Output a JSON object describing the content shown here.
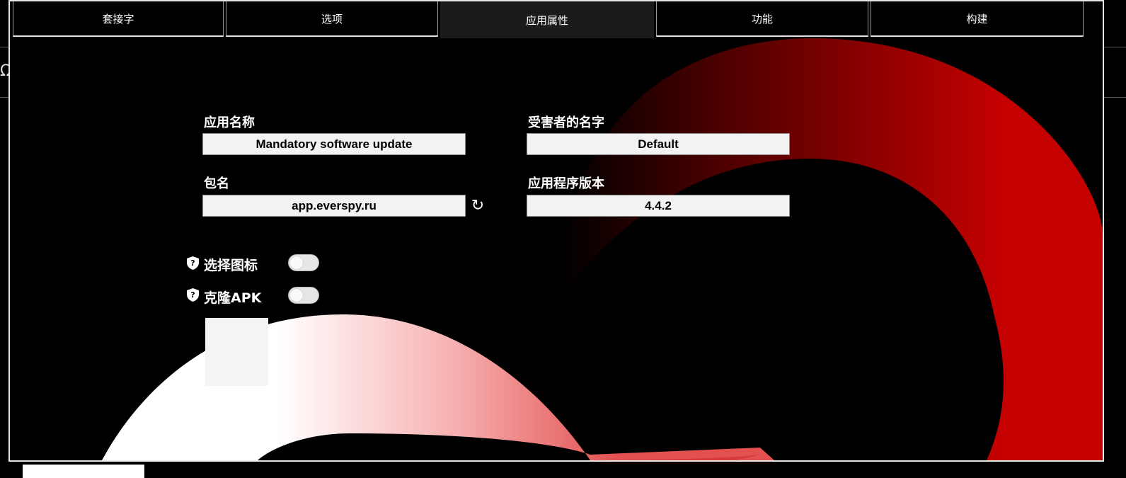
{
  "tabs": [
    {
      "label": "套接字",
      "active": false
    },
    {
      "label": "选项",
      "active": false
    },
    {
      "label": "应用属性",
      "active": true
    },
    {
      "label": "功能",
      "active": false
    },
    {
      "label": "构建",
      "active": false
    }
  ],
  "form": {
    "app_name_label": "应用名称",
    "app_name_value": "Mandatory software update",
    "victim_name_label": "受害者的名字",
    "victim_name_value": "Default",
    "package_label": "包名",
    "package_value": "app.everspy.ru",
    "version_label": "应用程序版本",
    "version_value": "4.4.2"
  },
  "options": {
    "select_icon_label": "选择图标",
    "select_icon_on": false,
    "clone_apk_label": "克隆APK",
    "clone_apk_on": false
  },
  "icons": {
    "refresh": "refresh-icon",
    "help": "shield-help-icon"
  },
  "colors": {
    "background": "#000000",
    "accent_red": "#c00000",
    "tab_active": "#1b1b1b",
    "field_bg": "#f2f2f2"
  },
  "host": {
    "edge_glyph": "Ω"
  }
}
